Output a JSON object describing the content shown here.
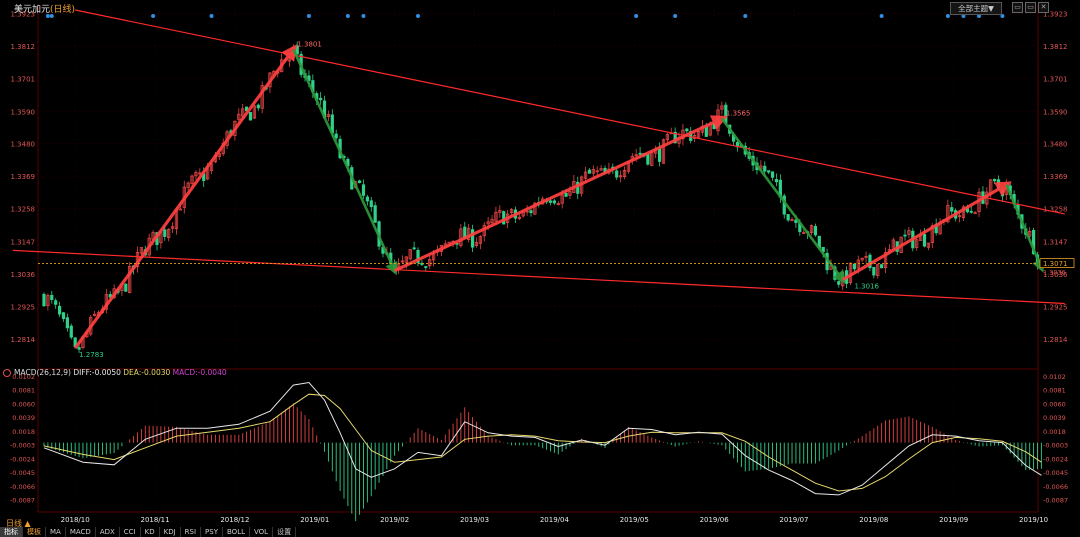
{
  "header": {
    "title": "美元加元",
    "period_badge": "(日线)",
    "theme_button": "全部主题▼",
    "window_controls": [
      "▭",
      "▭",
      "✕"
    ]
  },
  "chart_data": {
    "type": "candlestick",
    "price_axis": {
      "ticks": [
        "1.3923",
        "1.3812",
        "1.3701",
        "1.3590",
        "1.3480",
        "1.3369",
        "1.3258",
        "1.3147",
        "1.3036",
        "1.2925",
        "1.2814"
      ],
      "ylim": [
        1.2722,
        1.3935
      ],
      "current_price_label": "1.3071",
      "current_price": 1.3071,
      "secondary_label": "1.3036"
    },
    "time_axis": {
      "labels": [
        "2018/10",
        "2018/11",
        "2018/12",
        "2019/01",
        "2019/02",
        "2019/03",
        "2019/04",
        "2019/05",
        "2019/06",
        "2019/07",
        "2019/08",
        "2019/09",
        "2019/10"
      ],
      "x_range": [
        0,
        250
      ]
    },
    "key_points": [
      {
        "label": "1.2783",
        "x": 8,
        "price": 1.2783
      },
      {
        "label": "1.3801",
        "x": 64,
        "price": 1.3801
      },
      {
        "label": "1.3565",
        "x": 174,
        "price": 1.3565
      },
      {
        "label": "1.3016",
        "x": 207,
        "price": 1.3016
      }
    ],
    "swing_points": [
      {
        "x": 8,
        "price": 1.2783
      },
      {
        "x": 64,
        "price": 1.3801
      },
      {
        "x": 90,
        "price": 1.3047
      },
      {
        "x": 174,
        "price": 1.3565
      },
      {
        "x": 205,
        "price": 1.3016
      },
      {
        "x": 247,
        "price": 1.334
      },
      {
        "x": 256,
        "price": 1.3056
      }
    ],
    "trend_lines": [
      {
        "name": "upper",
        "from": {
          "x": 8,
          "price": 1.3935
        },
        "to": {
          "x": 262,
          "price": 1.324
        }
      },
      {
        "name": "lower",
        "from": {
          "x": -8,
          "price": 1.3116
        },
        "to": {
          "x": 262,
          "price": 1.2935
        }
      }
    ],
    "event_markers_x": [
      1,
      2,
      28,
      43,
      68,
      78,
      82,
      96,
      152,
      162,
      180,
      215,
      232,
      236,
      240,
      246
    ],
    "macd": {
      "label": "MACD(26,12,9)",
      "diff_label": "DIFF:-0.0050",
      "dea_label": "DEA:-0.0030",
      "macd_label": "MACD:-0.0040",
      "ticks": [
        "0.0102",
        "0.0081",
        "0.0060",
        "0.0039",
        "0.0018",
        "-0.0003",
        "-0.0024",
        "-0.0045",
        "-0.0066",
        "-0.0087"
      ],
      "ylim": [
        -0.01,
        0.0108
      ],
      "diff_points": [
        [
          0,
          -0.0008
        ],
        [
          10,
          -0.003
        ],
        [
          18,
          -0.0034
        ],
        [
          26,
          0.0005
        ],
        [
          34,
          0.0022
        ],
        [
          42,
          0.0022
        ],
        [
          50,
          0.0028
        ],
        [
          58,
          0.0048
        ],
        [
          64,
          0.0088
        ],
        [
          68,
          0.0092
        ],
        [
          72,
          0.0065
        ],
        [
          76,
          0.0015
        ],
        [
          80,
          -0.004
        ],
        [
          84,
          -0.0053
        ],
        [
          90,
          -0.004
        ],
        [
          96,
          -0.0015
        ],
        [
          102,
          -0.002
        ],
        [
          108,
          0.0032
        ],
        [
          114,
          0.0015
        ],
        [
          120,
          0.001
        ],
        [
          126,
          0.0008
        ],
        [
          132,
          -0.0006
        ],
        [
          138,
          0.0004
        ],
        [
          144,
          -0.0004
        ],
        [
          150,
          0.0022
        ],
        [
          156,
          0.002
        ],
        [
          162,
          0.0012
        ],
        [
          168,
          0.0016
        ],
        [
          174,
          0.0013
        ],
        [
          180,
          -0.002
        ],
        [
          186,
          -0.0042
        ],
        [
          192,
          -0.0058
        ],
        [
          198,
          -0.0078
        ],
        [
          204,
          -0.008
        ],
        [
          210,
          -0.0065
        ],
        [
          216,
          -0.0035
        ],
        [
          222,
          -0.0005
        ],
        [
          228,
          0.0012
        ],
        [
          234,
          0.001
        ],
        [
          240,
          0.0003
        ],
        [
          246,
          0.0
        ],
        [
          252,
          -0.0035
        ],
        [
          256,
          -0.005
        ]
      ],
      "dea_points": [
        [
          0,
          -0.0005
        ],
        [
          10,
          -0.0018
        ],
        [
          18,
          -0.0026
        ],
        [
          26,
          -0.0008
        ],
        [
          34,
          0.001
        ],
        [
          42,
          0.0016
        ],
        [
          50,
          0.0022
        ],
        [
          58,
          0.0032
        ],
        [
          64,
          0.0058
        ],
        [
          68,
          0.0074
        ],
        [
          72,
          0.0072
        ],
        [
          76,
          0.0052
        ],
        [
          80,
          0.002
        ],
        [
          84,
          -0.0012
        ],
        [
          90,
          -0.003
        ],
        [
          96,
          -0.0026
        ],
        [
          102,
          -0.0022
        ],
        [
          108,
          0.0005
        ],
        [
          114,
          0.001
        ],
        [
          120,
          0.0012
        ],
        [
          126,
          0.001
        ],
        [
          132,
          0.0003
        ],
        [
          138,
          0.0001
        ],
        [
          144,
          0.0
        ],
        [
          150,
          0.001
        ],
        [
          156,
          0.0016
        ],
        [
          162,
          0.0015
        ],
        [
          168,
          0.0015
        ],
        [
          174,
          0.0015
        ],
        [
          180,
          0.0002
        ],
        [
          186,
          -0.0022
        ],
        [
          192,
          -0.0042
        ],
        [
          198,
          -0.0062
        ],
        [
          204,
          -0.0074
        ],
        [
          210,
          -0.007
        ],
        [
          216,
          -0.0052
        ],
        [
          222,
          -0.0025
        ],
        [
          228,
          0.0
        ],
        [
          234,
          0.0008
        ],
        [
          240,
          0.0006
        ],
        [
          246,
          0.0002
        ],
        [
          252,
          -0.0014
        ],
        [
          256,
          -0.003
        ]
      ]
    }
  },
  "bottom": {
    "period_label": "日线 ▲",
    "tabs": [
      "指标",
      "模板",
      "MA",
      "MACD",
      "ADX",
      "CCI",
      "KD",
      "KDJ",
      "RSI",
      "PSY",
      "BOLL",
      "VOL",
      "设置"
    ]
  },
  "colors": {
    "up": "#e84545",
    "down": "#2fd08a",
    "trend_up": "#ff4040",
    "trend_down": "#2d9a3a",
    "channel": "#ff2a2a",
    "axis_text": "#e05555",
    "grid": "#2a0000",
    "marker": "#2f8fe0",
    "dash": "#e8a020",
    "diff": "#e8e8e8",
    "dea": "#e6d86b"
  }
}
